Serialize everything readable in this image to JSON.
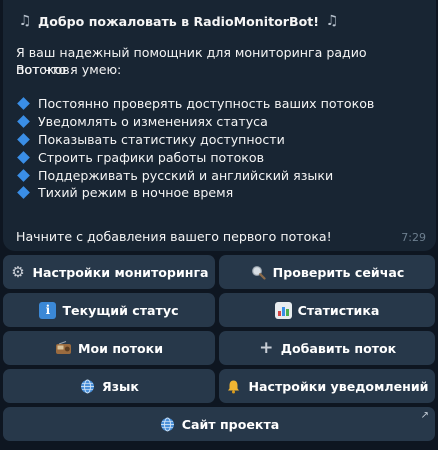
{
  "message": {
    "title": "Добро пожаловать в RadioMonitorBot!",
    "intro_line_1": "Я ваш надежный помощник для мониторинга радио потоков.",
    "intro_line_2": "Вот что я умею:",
    "features": [
      "Постоянно проверять доступность ваших потоков",
      "Уведомлять о изменениях статуса",
      "Показывать статистику доступности",
      "Строить графики работы потоков",
      "Поддерживать русский и английский языки",
      "Тихий режим в ночное время"
    ],
    "closing": "Начните с добавления вашего первого потока!",
    "time": "7:29"
  },
  "keyboard": {
    "monitoring_settings": "Настройки мониторинга",
    "check_now": "Проверить сейчас",
    "current_status": "Текущий статус",
    "statistics": "Статистика",
    "my_streams": "Мои потоки",
    "add_stream": "Добавить поток",
    "language": "Язык",
    "notification_settings": "Настройки уведомлений",
    "project_site": "Сайт проекта"
  },
  "icons": {
    "title": "music-notes-icon",
    "feature_bullet": "blue-diamond-icon",
    "monitoring_settings": "gear-icon",
    "check_now": "magnifier-icon",
    "current_status": "info-icon",
    "statistics": "bar-chart-icon",
    "my_streams": "radio-icon",
    "add_stream": "plus-icon",
    "language": "globe-icon",
    "notification_settings": "bell-icon",
    "project_site": "globe-icon",
    "external_link": "arrow-up-right-icon"
  },
  "colors": {
    "background": "#0e1621",
    "bubble": "#182533",
    "button": "#27384a",
    "accent_blue": "#3a8ee6"
  }
}
